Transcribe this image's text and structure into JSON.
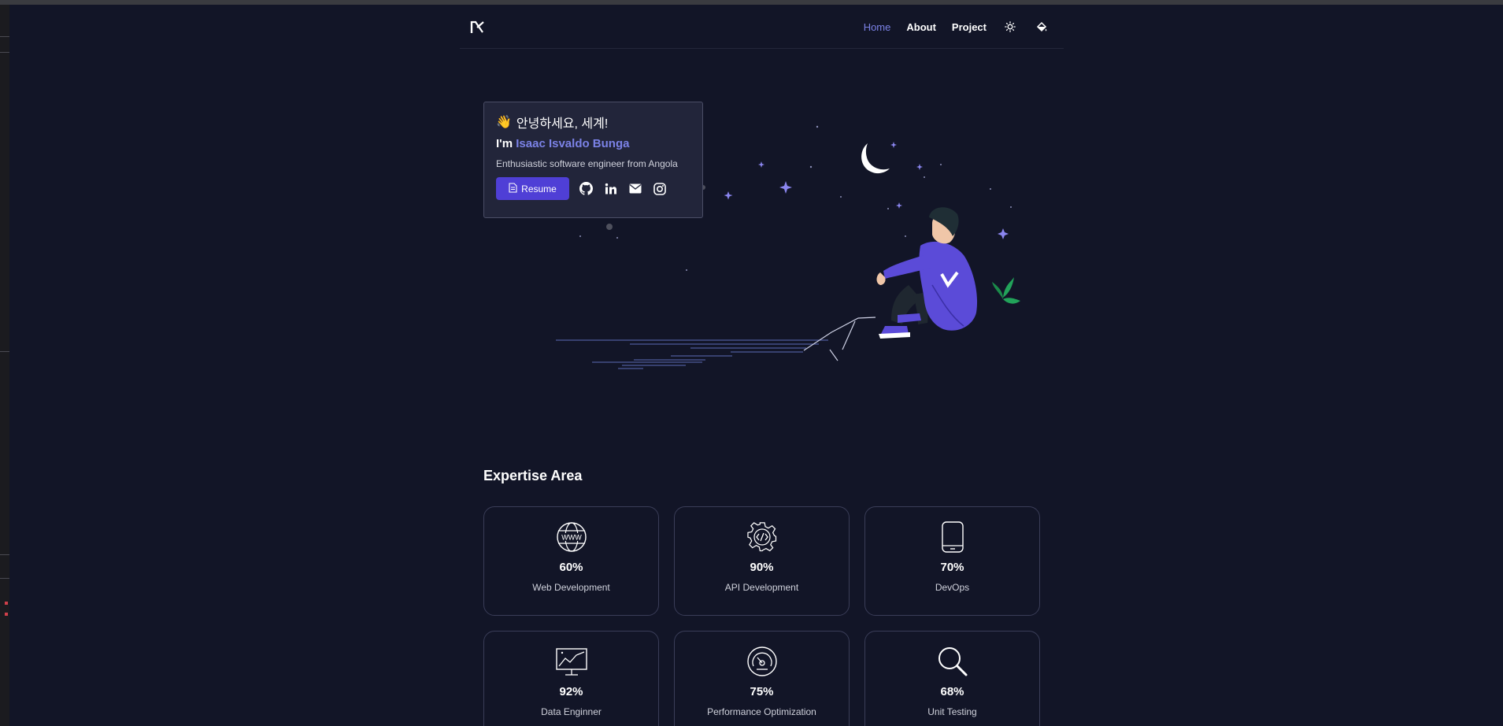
{
  "nav": {
    "items": [
      {
        "label": "Home",
        "active": true
      },
      {
        "label": "About",
        "active": false
      },
      {
        "label": "Project",
        "active": false
      }
    ],
    "icons": [
      "sun-icon",
      "paint-bucket-icon"
    ]
  },
  "hero": {
    "greeting": "안녕하세요, 세계!",
    "greeting_emoji": "👋",
    "im_prefix": "I'm",
    "name": "Isaac Isvaldo Bunga",
    "tagline": "Enthusiastic software engineer from Angola",
    "resume_label": "Resume",
    "socials": [
      "github-icon",
      "linkedin-icon",
      "mail-icon",
      "instagram-icon"
    ]
  },
  "expertise": {
    "title": "Expertise Area",
    "cards": [
      {
        "icon": "globe-www-icon",
        "percent": "60%",
        "label": "Web Development"
      },
      {
        "icon": "gear-code-icon",
        "percent": "90%",
        "label": "API Development"
      },
      {
        "icon": "tablet-icon",
        "percent": "70%",
        "label": "DevOps"
      },
      {
        "icon": "chart-monitor-icon",
        "percent": "92%",
        "label": "Data Enginner"
      },
      {
        "icon": "speedometer-icon",
        "percent": "75%",
        "label": "Performance Optimization"
      },
      {
        "icon": "magnifier-icon",
        "percent": "68%",
        "label": "Unit Testing"
      }
    ]
  },
  "colors": {
    "background": "#121527",
    "accent": "#7b82e6",
    "button": "#4f3fd6",
    "card_border": "#3a3d58"
  }
}
